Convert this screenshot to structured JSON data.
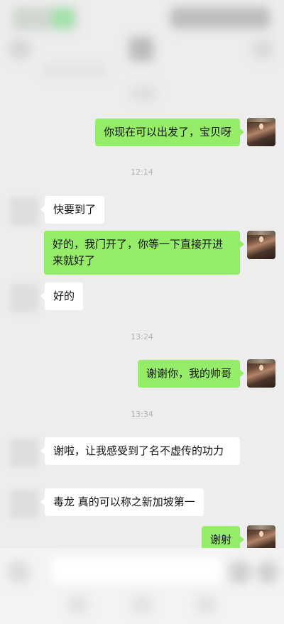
{
  "chat": {
    "messages": [
      {
        "side": "me",
        "text": "你现在可以出发了，宝贝呀"
      },
      {
        "time": "12:14"
      },
      {
        "side": "them",
        "text": "快要到了"
      },
      {
        "side": "me",
        "text": "好的，我门开了，你等一下直接开进来就好了"
      },
      {
        "side": "them",
        "text": "好的"
      },
      {
        "time": "13:24"
      },
      {
        "side": "me",
        "text": "谢谢你，我的帅哥"
      },
      {
        "time": "13:34"
      },
      {
        "side": "them",
        "text": "谢啦，让我感受到了名不虚传的功力"
      },
      {
        "side": "them",
        "text": "毒龙 真的可以称之新加坡第一"
      },
      {
        "side": "me",
        "text": "谢射"
      }
    ]
  },
  "colors": {
    "background": "#ededed",
    "my_bubble": "#95ec69",
    "their_bubble": "#ffffff",
    "timestamp": "#b2b2b2"
  }
}
